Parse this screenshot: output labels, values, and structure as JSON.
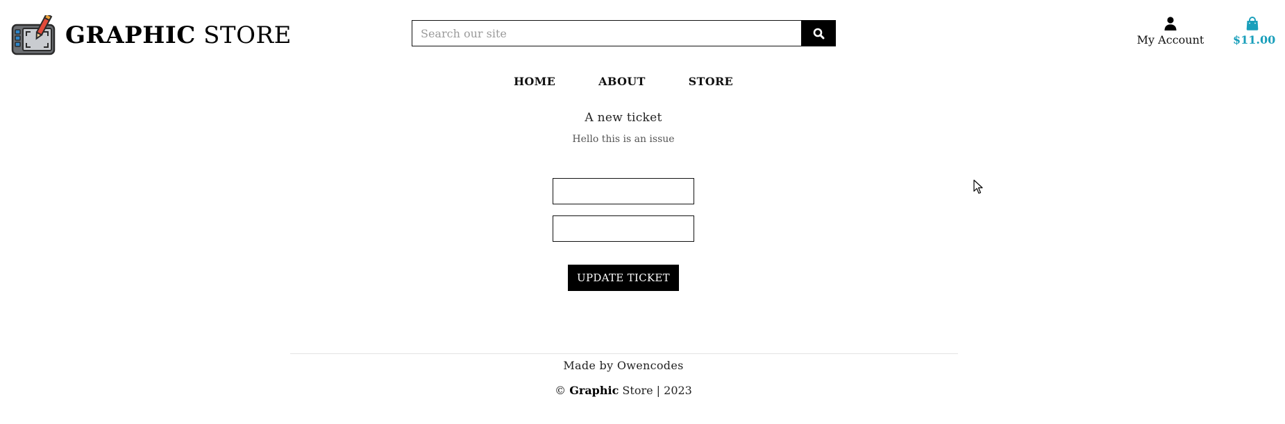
{
  "header": {
    "logo": {
      "brand_bold": "GRAPHIC",
      "brand_light": "STORE",
      "icon": "drawing-tablet-icon"
    },
    "search": {
      "placeholder": "Search our site",
      "value": "",
      "button_icon": "search-icon"
    },
    "account": {
      "label": "My Account",
      "icon": "user-icon"
    },
    "bag": {
      "total": "$11.00",
      "icon": "shopping-bag-icon",
      "color": "#1a9fbb"
    }
  },
  "nav": {
    "items": [
      {
        "label": "HOME"
      },
      {
        "label": "ABOUT"
      },
      {
        "label": "STORE"
      }
    ]
  },
  "main": {
    "ticket_title": "A new ticket",
    "ticket_body": "Hello this is an issue",
    "field_1_value": "",
    "field_2_value": "",
    "update_button_label": "UPDATE TICKET"
  },
  "footer": {
    "made_by": "Made by Owencodes",
    "copyright_symbol": "©",
    "brand_bold": "Graphic",
    "brand_light": "Store",
    "separator": "|",
    "year": "2023"
  }
}
